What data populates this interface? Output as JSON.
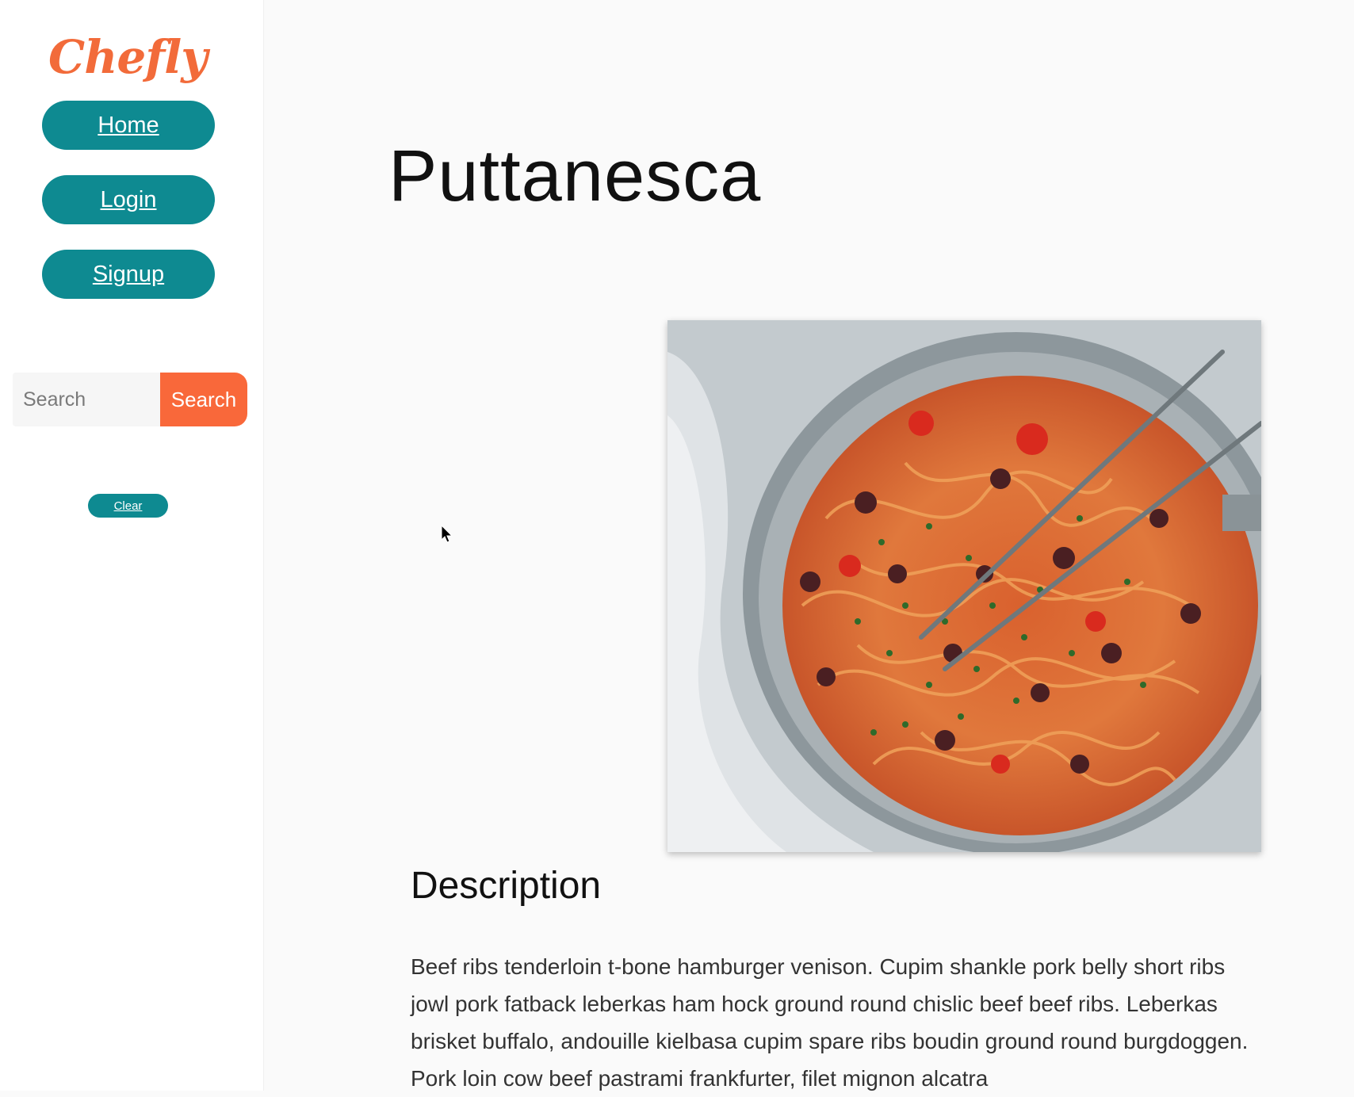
{
  "sidebar": {
    "logo": "Chefly",
    "nav": [
      {
        "label": "Home"
      },
      {
        "label": "Login"
      },
      {
        "label": "Signup"
      }
    ],
    "search": {
      "placeholder": "Search",
      "value": "",
      "button_label": "Search"
    },
    "clear_label": "Clear"
  },
  "recipe": {
    "title": "Puttanesca",
    "image": {
      "icon": "pasta-photo"
    },
    "description_heading": "Description",
    "description": "Beef ribs tenderloin t-bone hamburger venison. Cupim shankle pork belly short ribs jowl pork fatback leberkas ham hock ground round chislic beef beef ribs. Leberkas brisket buffalo, andouille kielbasa cupim spare ribs boudin ground round burgdoggen. Pork loin cow beef pastrami frankfurter, filet mignon alcatra"
  },
  "colors": {
    "brand_orange": "#f26b3a",
    "teal": "#0e8a91",
    "search_orange": "#f9683a",
    "page_bg": "#fafafa"
  }
}
